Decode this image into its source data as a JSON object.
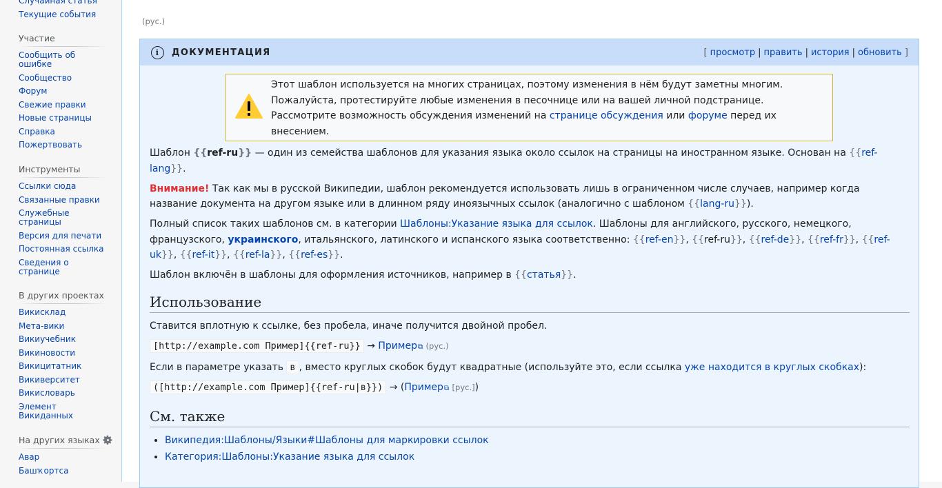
{
  "sidebar": {
    "top_items": [
      "Случайная статья",
      "Текущие события"
    ],
    "participation": {
      "heading": "Участие",
      "items": [
        "Сообщить об ошибке",
        "Сообщество",
        "Форум",
        "Свежие правки",
        "Новые страницы",
        "Справка",
        "Пожертвовать"
      ]
    },
    "tools": {
      "heading": "Инструменты",
      "items": [
        "Ссылки сюда",
        "Связанные правки",
        "Служебные страницы",
        "Версия для печати",
        "Постоянная ссылка",
        "Сведения о странице"
      ]
    },
    "projects": {
      "heading": "В других проектах",
      "items": [
        "Викисклад",
        "Мета-вики",
        "Викиучебник",
        "Викиновости",
        "Викицитатник",
        "Викиверситет",
        "Викисловарь",
        "Элемент Викиданных"
      ]
    },
    "languages": {
      "heading": "На других языках",
      "items": [
        "Авар",
        "Башҡортса"
      ]
    }
  },
  "content": {
    "top_note": "(рус.)",
    "doc": {
      "title": "ДОКУМЕНТАЦИЯ",
      "links": [
        "просмотр",
        "править",
        "история",
        "обновить"
      ],
      "bracket_open": "[",
      "bracket_close": "]",
      "sep": "|"
    },
    "warning": {
      "text1": "Этот шаблон используется на многих страницах, поэтому изменения в нём будут заметны многим. Пожалуйста, протестируйте любые изменения в песочнице или на вашей личной подстранице. Рассмотрите возможность обсуждения изменений на ",
      "link1": "странице обсуждения",
      "text2": " или ",
      "link2": "форуме",
      "text3": " перед их внесением."
    },
    "p1": {
      "a": "Шаблон ",
      "tmpl": "ref-ru",
      "b": " — один из семейства шаблонов для указания языка около ссылок на страницы на иностранном языке. Основан на ",
      "link": "ref-lang",
      "c": "."
    },
    "p2": {
      "bold": "Внимание!",
      "a": " Так как мы в русской Википедии, шаблон рекомендуется использовать лишь в ограниченном числе случаев, например когда название документа на другом языке или в длинном ряду иноязычных ссылок (аналогично с шаблоном ",
      "link": "lang-ru",
      "b": ")."
    },
    "p3": {
      "a": "Полный список таких шаблонов см. в категории ",
      "cat": "Шаблоны:Указание языка для ссылок",
      "b": ". Шаблоны для английского, русского, немецкого, французского, ",
      "uk_bold": "украинского",
      "c": ", итальянского, латинского и испанского языка соответственно: ",
      "tmpls": [
        "ref-en",
        "ref-ru",
        "ref-de",
        "ref-fr",
        "ref-uk",
        "ref-it",
        "ref-la",
        "ref-es"
      ],
      "d": "."
    },
    "p4": {
      "a": "Шаблон включён в шаблоны для оформления источников, например в ",
      "link": "статья",
      "b": "."
    },
    "usage": {
      "heading": "Использование",
      "line1": "Ставится вплотную к ссылке, без пробела, иначе получится двойной пробел.",
      "code1": "[http://example.com Пример]{{ref-ru}}",
      "arrow": "→",
      "result_link": "Пример",
      "result_lang": "(рус.)",
      "line2a": "Если в параметре указать ",
      "line2_code": "в",
      "line2b": ", вместо круглых скобок будут квадратные (используйте это, если ссылка ",
      "line2_link": "уже находится в круглых скобках",
      "line2c": "):",
      "code2": "([http://example.com Пример]{{ref-ru|в}})",
      "result2_open": "(",
      "result2_link": "Пример",
      "result2_lang": "[рус.]",
      "result2_close": ")"
    },
    "see_also": {
      "heading": "См. также",
      "items": [
        "Википедия:Шаблоны/Языки#Шаблоны для маркировки ссылок",
        "Категория:Шаблоны:Указание языка для ссылок"
      ]
    }
  },
  "colors": {
    "link": "#0645ad",
    "doc_bg": "#ecf5fe",
    "doc_header": "#c7ddfa",
    "warning_border": "#d4b531",
    "warning_icon": "#fc3",
    "attention": "#d33"
  }
}
